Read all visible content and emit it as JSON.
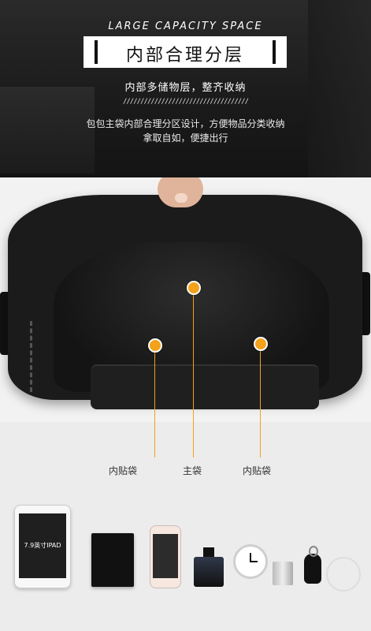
{
  "header": {
    "tagline": "LARGE CAPACITY SPACE",
    "title": "内部合理分层",
    "subtitle": "内部多储物层，整齐收纳",
    "divider": "////////////////////////////////////",
    "description_line1": "包包主袋内部合理分区设计，方便物品分类收纳",
    "description_line2": "拿取自如，便捷出行"
  },
  "labels": {
    "left": "内贴袋",
    "center": "主袋",
    "right": "内贴袋"
  },
  "items": {
    "ipad_text": "7.9英寸IPAD"
  },
  "colors": {
    "accent": "#f2a21b",
    "dark": "#1a1a1a"
  }
}
